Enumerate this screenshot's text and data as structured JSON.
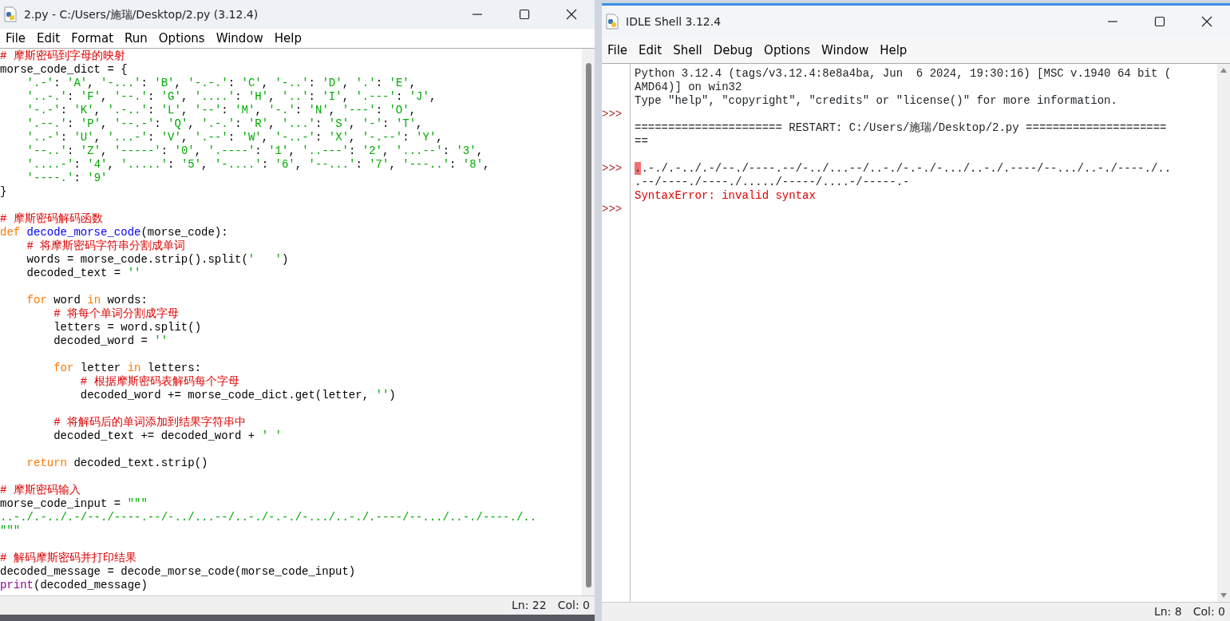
{
  "editor_window": {
    "title": "2.py - C:/Users/施瑞/Desktop/2.py (3.12.4)",
    "menu": [
      "File",
      "Edit",
      "Format",
      "Run",
      "Options",
      "Window",
      "Help"
    ],
    "lines": [
      {
        "kind": "text",
        "spans": [
          {
            "kind": "comment",
            "text": "# 摩斯密码到字母的映射"
          }
        ]
      },
      {
        "kind": "text",
        "spans": [
          {
            "kind": "code",
            "text": "morse_code_dict = {"
          }
        ]
      },
      {
        "kind": "text",
        "spans": [
          {
            "kind": "code",
            "text": "    '.-': 'A', '-...': 'B', '-.-.': 'C', '-..': 'D', '.': 'E',"
          }
        ]
      },
      {
        "kind": "text",
        "spans": [
          {
            "kind": "code",
            "text": "    '..-.': 'F', '--.': 'G', '....': 'H', '..': 'I', '.---': 'J',"
          }
        ]
      },
      {
        "kind": "text",
        "spans": [
          {
            "kind": "code",
            "text": "    '-.-': 'K', '.-..': 'L', '--': 'M', '-.': 'N', '---': 'O',"
          }
        ]
      },
      {
        "kind": "text",
        "spans": [
          {
            "kind": "code",
            "text": "    '.--.': 'P', '--.-': 'Q', '.-.': 'R', '...': 'S', '-': 'T',"
          }
        ]
      },
      {
        "kind": "text",
        "spans": [
          {
            "kind": "code",
            "text": "    '..-': 'U', '...-': 'V', '.--': 'W', '-..-': 'X', '-.--': 'Y',"
          }
        ]
      },
      {
        "kind": "text",
        "spans": [
          {
            "kind": "code",
            "text": "    '--..': 'Z', '-----': '0', '.----': '1', '..---': '2', '...--': '3',"
          }
        ]
      },
      {
        "kind": "text",
        "spans": [
          {
            "kind": "code",
            "text": "    '....-': '4', '.....': '5', '-....': '6', '--...': '7', '---..': '8',"
          }
        ]
      },
      {
        "kind": "text",
        "spans": [
          {
            "kind": "code",
            "text": "    '----.': '9'"
          }
        ]
      },
      {
        "kind": "text",
        "spans": [
          {
            "kind": "code",
            "text": "}"
          }
        ]
      },
      {
        "kind": "blank"
      },
      {
        "kind": "text",
        "spans": [
          {
            "kind": "comment",
            "text": "# 摩斯密码解码函数"
          }
        ]
      },
      {
        "kind": "text",
        "spans": [
          {
            "kind": "keyword",
            "text": "def "
          },
          {
            "kind": "defname",
            "text": "decode_morse_code"
          },
          {
            "kind": "code",
            "text": "(morse_code):"
          }
        ]
      },
      {
        "kind": "text",
        "spans": [
          {
            "kind": "comment",
            "text": "    # 将摩斯密码字符串分割成单词"
          }
        ]
      },
      {
        "kind": "text",
        "spans": [
          {
            "kind": "code",
            "text": "    words = morse_code.strip().split('   ')"
          }
        ]
      },
      {
        "kind": "text",
        "spans": [
          {
            "kind": "code",
            "text": "    decoded_text = ''"
          }
        ]
      },
      {
        "kind": "blank"
      },
      {
        "kind": "text",
        "spans": [
          {
            "kind": "keyword",
            "text": "    for"
          },
          {
            "kind": "code",
            "text": " word "
          },
          {
            "kind": "keyword",
            "text": "in"
          },
          {
            "kind": "code",
            "text": " words:"
          }
        ]
      },
      {
        "kind": "text",
        "spans": [
          {
            "kind": "comment",
            "text": "        # 将每个单词分割成字母"
          }
        ]
      },
      {
        "kind": "text",
        "spans": [
          {
            "kind": "code",
            "text": "        letters = word.split()"
          }
        ]
      },
      {
        "kind": "text",
        "spans": [
          {
            "kind": "code",
            "text": "        decoded_word = ''"
          }
        ]
      },
      {
        "kind": "blank"
      },
      {
        "kind": "text",
        "spans": [
          {
            "kind": "keyword",
            "text": "        for"
          },
          {
            "kind": "code",
            "text": " letter "
          },
          {
            "kind": "keyword",
            "text": "in"
          },
          {
            "kind": "code",
            "text": " letters:"
          }
        ]
      },
      {
        "kind": "text",
        "spans": [
          {
            "kind": "comment",
            "text": "            # 根据摩斯密码表解码每个字母"
          }
        ]
      },
      {
        "kind": "text",
        "spans": [
          {
            "kind": "code",
            "text": "            decoded_word += morse_code_dict.get(letter, '')"
          }
        ]
      },
      {
        "kind": "blank"
      },
      {
        "kind": "text",
        "spans": [
          {
            "kind": "comment",
            "text": "        # 将解码后的单词添加到结果字符串中"
          }
        ]
      },
      {
        "kind": "text",
        "spans": [
          {
            "kind": "code",
            "text": "        decoded_text += decoded_word + ' '"
          }
        ]
      },
      {
        "kind": "blank"
      },
      {
        "kind": "text",
        "spans": [
          {
            "kind": "keyword",
            "text": "    return"
          },
          {
            "kind": "code",
            "text": " decoded_text.strip()"
          }
        ]
      },
      {
        "kind": "blank"
      },
      {
        "kind": "text",
        "spans": [
          {
            "kind": "comment",
            "text": "# 摩斯密码输入"
          }
        ]
      },
      {
        "kind": "text",
        "spans": [
          {
            "kind": "code",
            "text": "morse_code_input = "
          },
          {
            "kind": "string",
            "text": "\"\"\""
          }
        ]
      },
      {
        "kind": "text",
        "spans": [
          {
            "kind": "string",
            "text": "..-./.-../.-/--./----.--/-../...--/..-./-.-./-.../..-./.----/--.../..-./----./.."
          }
        ]
      },
      {
        "kind": "text",
        "spans": [
          {
            "kind": "string",
            "text": "\"\"\""
          }
        ]
      },
      {
        "kind": "blank"
      },
      {
        "kind": "text",
        "spans": [
          {
            "kind": "comment",
            "text": "# 解码摩斯密码并打印结果"
          }
        ]
      },
      {
        "kind": "text",
        "spans": [
          {
            "kind": "code",
            "text": "decoded_message = decode_morse_code(morse_code_input)"
          }
        ]
      },
      {
        "kind": "text",
        "spans": [
          {
            "kind": "builtin",
            "text": "print"
          },
          {
            "kind": "code",
            "text": "(decoded_message)"
          }
        ]
      }
    ],
    "status": {
      "line": "Ln: 22",
      "col": "Col: 0"
    }
  },
  "shell_window": {
    "title": "IDLE Shell 3.12.4",
    "menu": [
      "File",
      "Edit",
      "Shell",
      "Debug",
      "Options",
      "Window",
      "Help"
    ],
    "rows": [
      {
        "kind": "output",
        "text": "Python 3.12.4 (tags/v3.12.4:8e8a4ba, Jun  6 2024, 19:30:16) [MSC v.1940 64 bit ("
      },
      {
        "kind": "output",
        "text": "AMD64)] on win32"
      },
      {
        "kind": "output",
        "text": "Type \"help\", \"copyright\", \"credits\" or \"license()\" for more information."
      },
      {
        "kind": "prompt",
        "prompt": ">>>"
      },
      {
        "kind": "output",
        "text": "====================== RESTART: C:/Users/施瑞/Desktop/2.py ====================="
      },
      {
        "kind": "output",
        "text": "=="
      },
      {
        "kind": "blank"
      },
      {
        "kind": "input",
        "prompt": ">>>",
        "cursor": ".",
        "text": ".-./.-../.-/--./----.--/-../...--/..-./-.-./-.../..-./.----/--.../..-./----./.."
      },
      {
        "kind": "input",
        "text": ".--/----./----./...../-----/....-/-----.-"
      },
      {
        "kind": "error",
        "text": "SyntaxError: invalid syntax"
      },
      {
        "kind": "prompt",
        "prompt": ">>>"
      }
    ],
    "status": {
      "line": "Ln: 8",
      "col": "Col: 0"
    }
  }
}
